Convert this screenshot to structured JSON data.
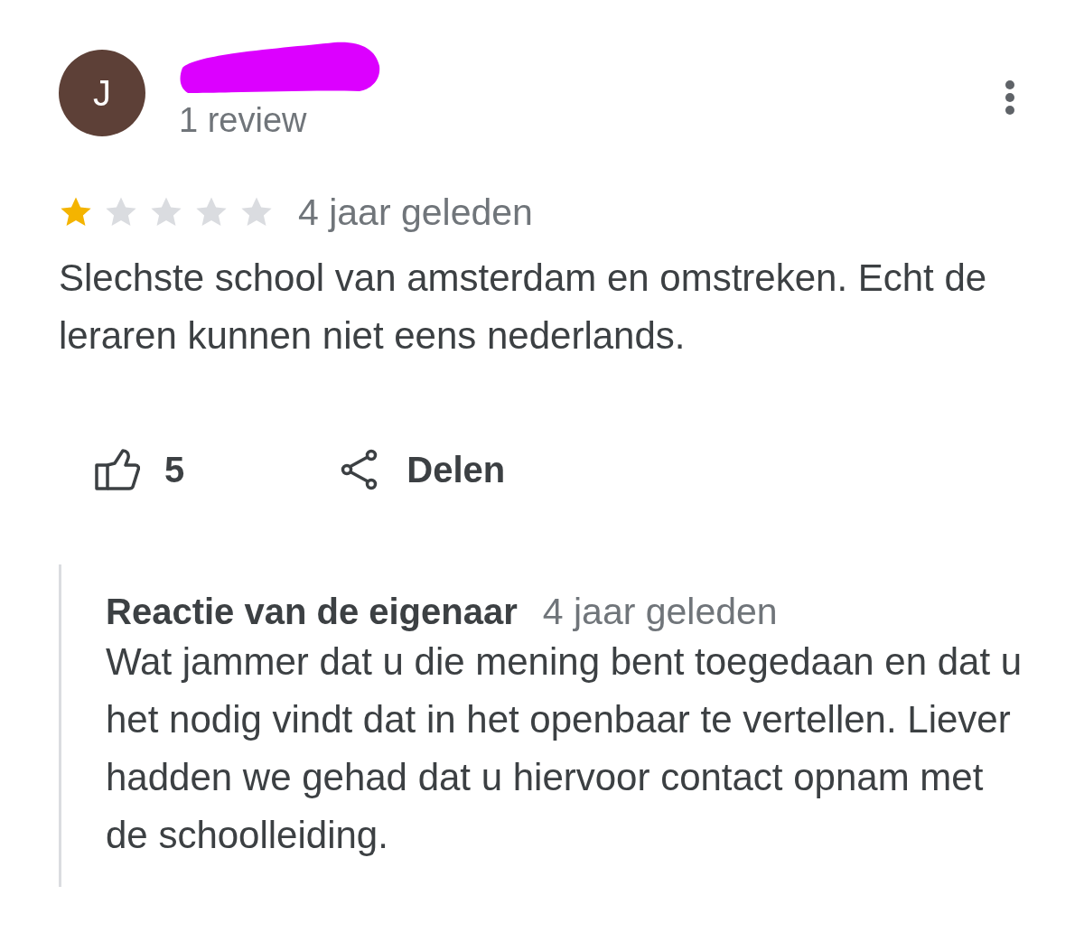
{
  "review": {
    "author": {
      "avatar_letter": "J",
      "review_count": "1 review"
    },
    "stars": 1,
    "time": "4 jaar geleden",
    "text": "Slechste school van amsterdam en omstreken. Echt de leraren kunnen niet eens nederlands.",
    "actions": [
      {
        "kind": "like",
        "label": "5"
      },
      {
        "kind": "share",
        "label": "Delen"
      }
    ]
  },
  "owner_reply": {
    "title": "Reactie van de eigenaar",
    "time": "4 jaar geleden",
    "text": "Wat jammer dat u die mening bent toegedaan en dat u het nodig vindt dat in het openbaar te vertellen. Liever hadden we gehad dat u hiervoor contact opnam met de schoolleiding."
  }
}
